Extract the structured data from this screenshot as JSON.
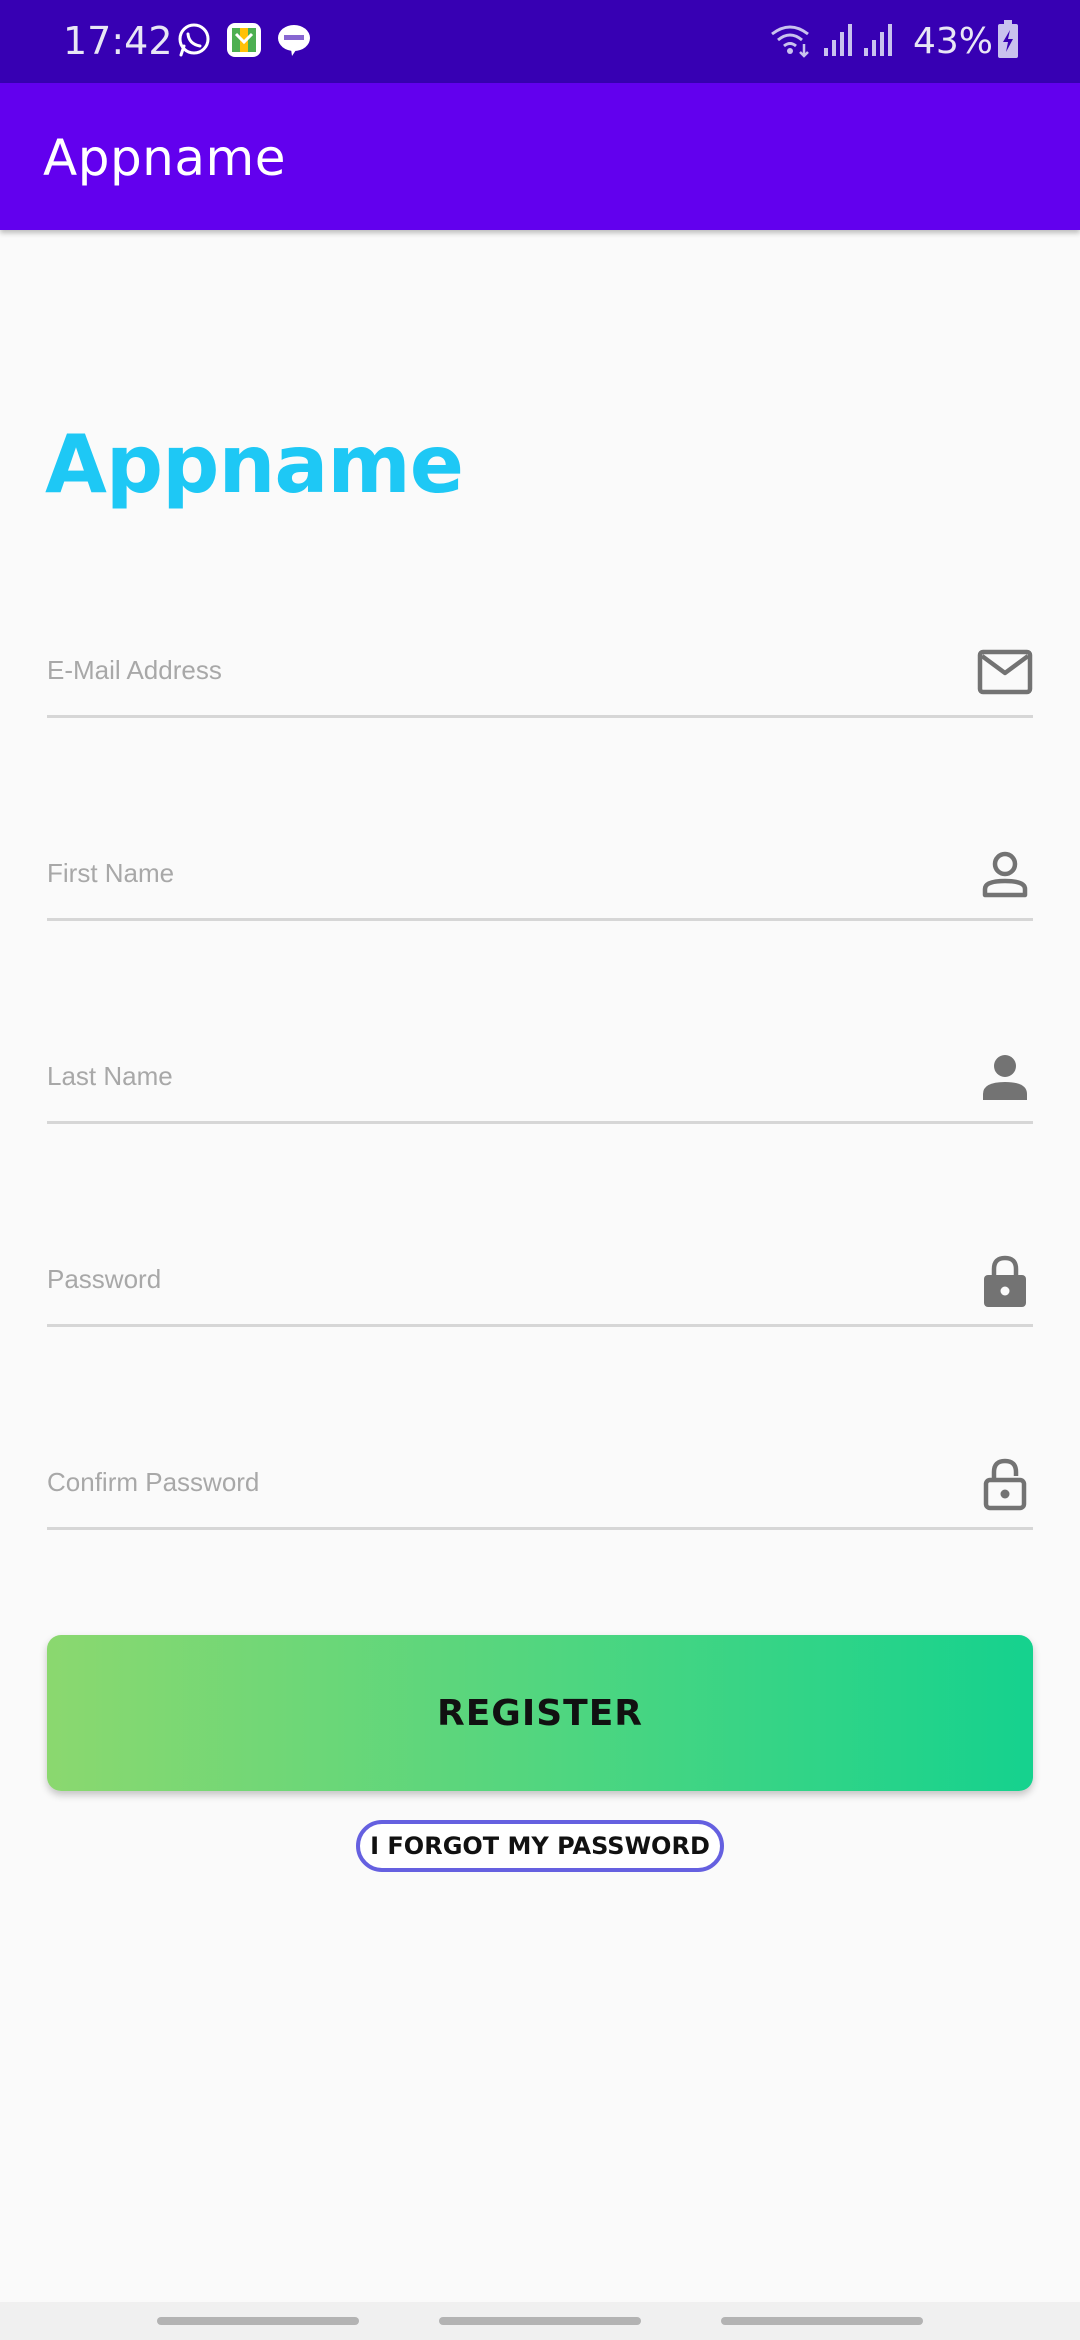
{
  "status_bar": {
    "time": "17:42",
    "battery_percent": "43%",
    "notification_icons": [
      "whatsapp-icon",
      "gallery-app-icon",
      "line-icon"
    ],
    "background": "#3700b3"
  },
  "app_bar": {
    "title": "Appname",
    "background": "#6200ee"
  },
  "brand": {
    "heading": "Appname",
    "color": "#1ec8f5"
  },
  "form": {
    "fields": [
      {
        "placeholder": "E-Mail Address",
        "value": "",
        "icon": "mail-icon"
      },
      {
        "placeholder": "First Name",
        "value": "",
        "icon": "person-outline-icon"
      },
      {
        "placeholder": "Last Name",
        "value": "",
        "icon": "person-filled-icon"
      },
      {
        "placeholder": "Password",
        "value": "",
        "icon": "lock-icon"
      },
      {
        "placeholder": "Confirm Password",
        "value": "",
        "icon": "lock-open-icon"
      }
    ],
    "register_label": "REGISTER",
    "forgot_label": "I FORGOT MY PASSWORD",
    "register_gradient": [
      "#8bd86f",
      "#15d28e"
    ],
    "forgot_border_color": "#6560e0"
  }
}
